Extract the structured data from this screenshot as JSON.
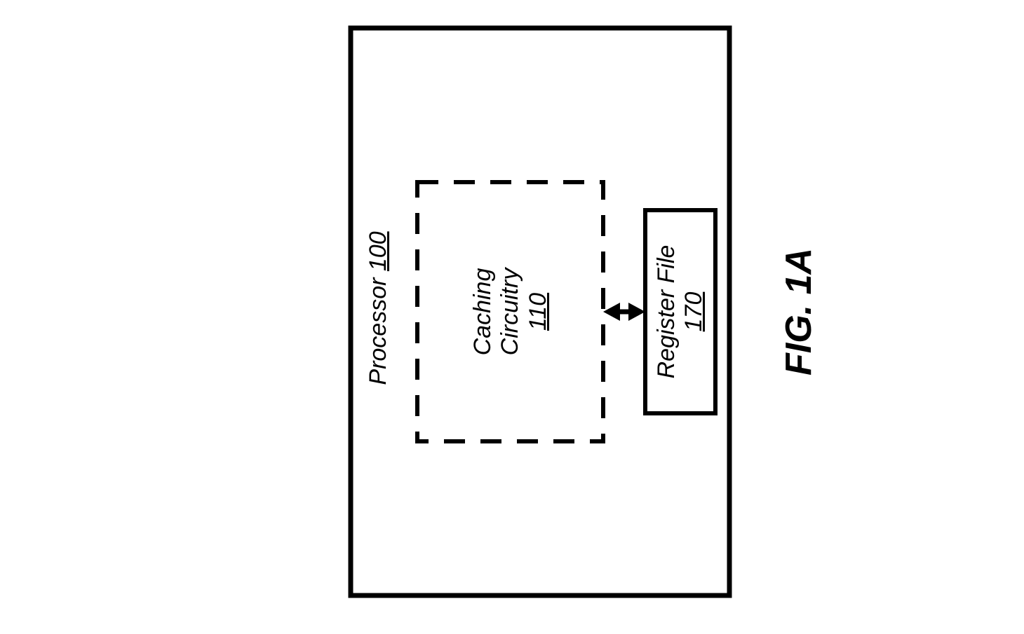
{
  "diagram": {
    "outerBox": {
      "label_prefix": "Processor ",
      "label_number": "100"
    },
    "cachingBox": {
      "line1": "Caching",
      "line2": "Circuitry",
      "number": "110"
    },
    "registerBox": {
      "line1": "Register File",
      "number": "170"
    },
    "figure_label": "FIG. 1A"
  },
  "chart_data": {
    "type": "block-diagram",
    "blocks": [
      {
        "id": "100",
        "name": "Processor",
        "border": "solid",
        "contains": [
          "110",
          "170"
        ]
      },
      {
        "id": "110",
        "name": "Caching Circuitry",
        "border": "dashed"
      },
      {
        "id": "170",
        "name": "Register File",
        "border": "solid"
      }
    ],
    "connections": [
      {
        "from": "110",
        "to": "170",
        "style": "bidirectional-arrow"
      }
    ],
    "figure": "FIG. 1A",
    "orientation": "rotated-90-ccw"
  }
}
